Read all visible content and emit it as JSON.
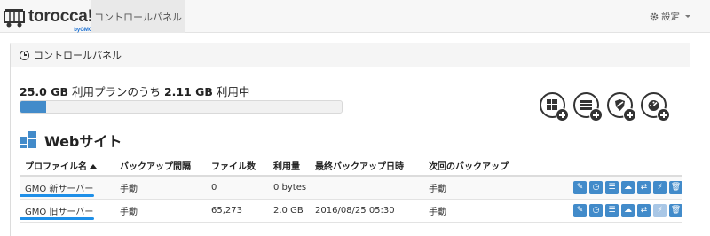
{
  "brand": {
    "name": "torocca!",
    "sub": "byGMO"
  },
  "nav": {
    "tab": "コントロールパネル",
    "settings": "設定"
  },
  "panel": {
    "title": "コントロールパネル"
  },
  "usage": {
    "plan": "25.0 GB",
    "plan_suffix": " 利用プランのうち ",
    "used": "2.11 GB",
    "used_suffix": " 利用中",
    "progress": 0.08
  },
  "actions": [
    "add-site",
    "add-database",
    "add-security",
    "add-monitor"
  ],
  "section": {
    "title": "Webサイト"
  },
  "table": {
    "headers": [
      "プロファイル名",
      "バックアップ間隔",
      "ファイル数",
      "利用量",
      "最終バックアップ日時",
      "次回のバックアップ"
    ],
    "rows": [
      {
        "name": "GMO 新サーバー",
        "interval": "手動",
        "files": "0",
        "usage": "0 bytes",
        "last": "",
        "next": "手動",
        "restore_enabled": true
      },
      {
        "name": "GMO 旧サーバー",
        "interval": "手動",
        "files": "65,273",
        "usage": "2.0 GB",
        "last": "2016/08/25 05:30",
        "next": "手動",
        "restore_enabled": false
      }
    ]
  },
  "colors": {
    "accent": "#428bca",
    "highlight": "#1e8fe8"
  }
}
